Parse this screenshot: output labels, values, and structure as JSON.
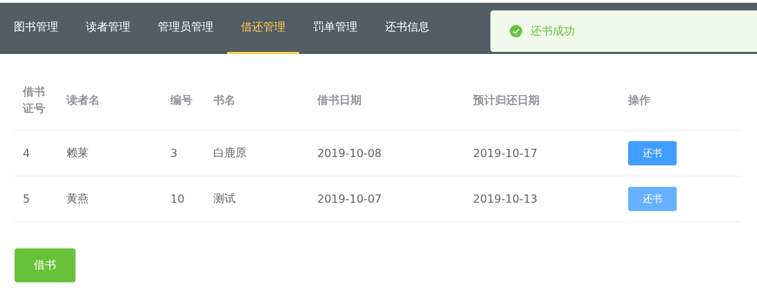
{
  "nav": {
    "tabs": [
      {
        "label": "图书管理",
        "selected": false
      },
      {
        "label": "读者管理",
        "selected": false
      },
      {
        "label": "管理员管理",
        "selected": false
      },
      {
        "label": "借还管理",
        "selected": true
      },
      {
        "label": "罚单管理",
        "selected": false
      },
      {
        "label": "还书信息",
        "selected": false
      }
    ]
  },
  "toast": {
    "kind": "success",
    "message": "还书成功"
  },
  "table": {
    "columns": [
      "借书证号",
      "读者名",
      "编号",
      "书名",
      "借书日期",
      "预计归还日期",
      "操作"
    ],
    "rows": [
      {
        "cells": [
          "4",
          "赖莱",
          "3",
          "白鹿原",
          "2019-10-08",
          "2019-10-17"
        ],
        "action": {
          "label": "还书",
          "hovered": false
        }
      },
      {
        "cells": [
          "5",
          "黄燕",
          "10",
          "测试",
          "2019-10-07",
          "2019-10-13"
        ],
        "action": {
          "label": "还书",
          "hovered": true
        }
      }
    ]
  },
  "borrow_button": "借书"
}
